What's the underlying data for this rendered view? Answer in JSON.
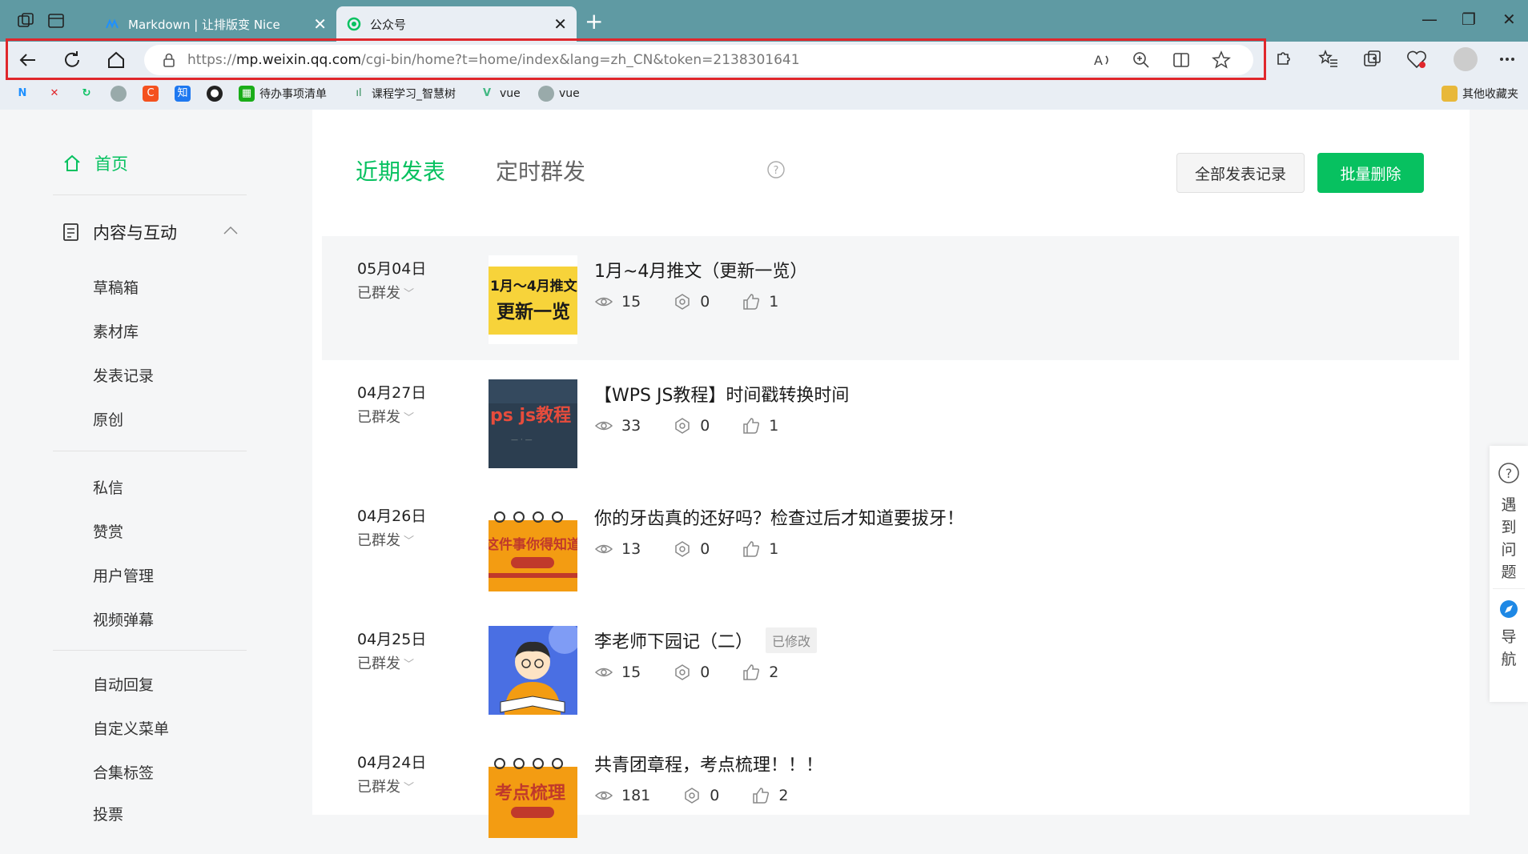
{
  "browser": {
    "tabs": [
      {
        "title": "Markdown | 让排版变 Nice",
        "icon": "markdown-nice-icon"
      },
      {
        "title": "公众号",
        "icon": "wechat-official-icon",
        "active": true
      }
    ],
    "address": {
      "url_prefix": "https://",
      "url_domain": "mp.weixin.qq.com",
      "url_path": "/cgi-bin/home?t=home/index&lang=zh_CN&token=2138301641"
    },
    "bookmarks": [
      {
        "label": "",
        "icon": "markdown-nice-icon"
      },
      {
        "label": "",
        "icon": "xmind-icon"
      },
      {
        "label": "",
        "icon": "refresh-green-icon"
      },
      {
        "label": "",
        "icon": "avatar-icon"
      },
      {
        "label": "",
        "icon": "csdn-icon"
      },
      {
        "label": "",
        "icon": "zhihu-icon"
      },
      {
        "label": "",
        "icon": "github-icon"
      },
      {
        "label": "待办事项清单",
        "icon": "todo-icon"
      },
      {
        "label": "课程学习_智慧树",
        "icon": "zhihuishu-icon"
      },
      {
        "label": "vue",
        "icon": "vue-icon"
      },
      {
        "label": "vue",
        "icon": "avatar-icon"
      }
    ],
    "other_bookmarks": "其他收藏夹"
  },
  "sidebar": {
    "home": "首页",
    "content_section": "内容与互动",
    "items": [
      "草稿箱",
      "素材库",
      "发表记录",
      "原创"
    ],
    "items2": [
      "私信",
      "赞赏",
      "用户管理",
      "视频弹幕"
    ],
    "items3": [
      "自动回复",
      "自定义菜单",
      "合集标签",
      "投票"
    ]
  },
  "main": {
    "tab_recent": "近期发表",
    "tab_scheduled": "定时群发",
    "btn_all_records": "全部发表记录",
    "btn_bulk_delete": "批量删除",
    "posts": [
      {
        "date": "05月04日",
        "status": "已群发",
        "title": "1月~4月推文（更新一览）",
        "tag": "",
        "views": "15",
        "shares": "0",
        "likes": "1",
        "thumb": "banner-yellow",
        "thumb_text": "1月～4月推文 更新一览"
      },
      {
        "date": "04月27日",
        "status": "已群发",
        "title": "【WPS JS教程】时间戳转换时间",
        "tag": "",
        "views": "33",
        "shares": "0",
        "likes": "1",
        "thumb": "dark",
        "thumb_text": "ps js教程"
      },
      {
        "date": "04月26日",
        "status": "已群发",
        "title": "你的牙齿真的还好吗？检查过后才知道要拔牙！",
        "tag": "",
        "views": "13",
        "shares": "0",
        "likes": "1",
        "thumb": "notebook",
        "thumb_text": "这件事你得知道"
      },
      {
        "date": "04月25日",
        "status": "已群发",
        "title": "李老师下园记（二）",
        "tag": "已修改",
        "views": "15",
        "shares": "0",
        "likes": "2",
        "thumb": "cartoon",
        "thumb_text": ""
      },
      {
        "date": "04月24日",
        "status": "已群发",
        "title": "共青团章程，考点梳理！！！",
        "tag": "",
        "views": "181",
        "shares": "0",
        "likes": "2",
        "thumb": "notebook",
        "thumb_text": "考点梳理"
      }
    ]
  },
  "float": {
    "help": "遇到问题",
    "nav": "导航"
  },
  "colors": {
    "accent": "#07c160",
    "highlight_box": "#e0272c",
    "tabbar": "#5f9aa3"
  }
}
